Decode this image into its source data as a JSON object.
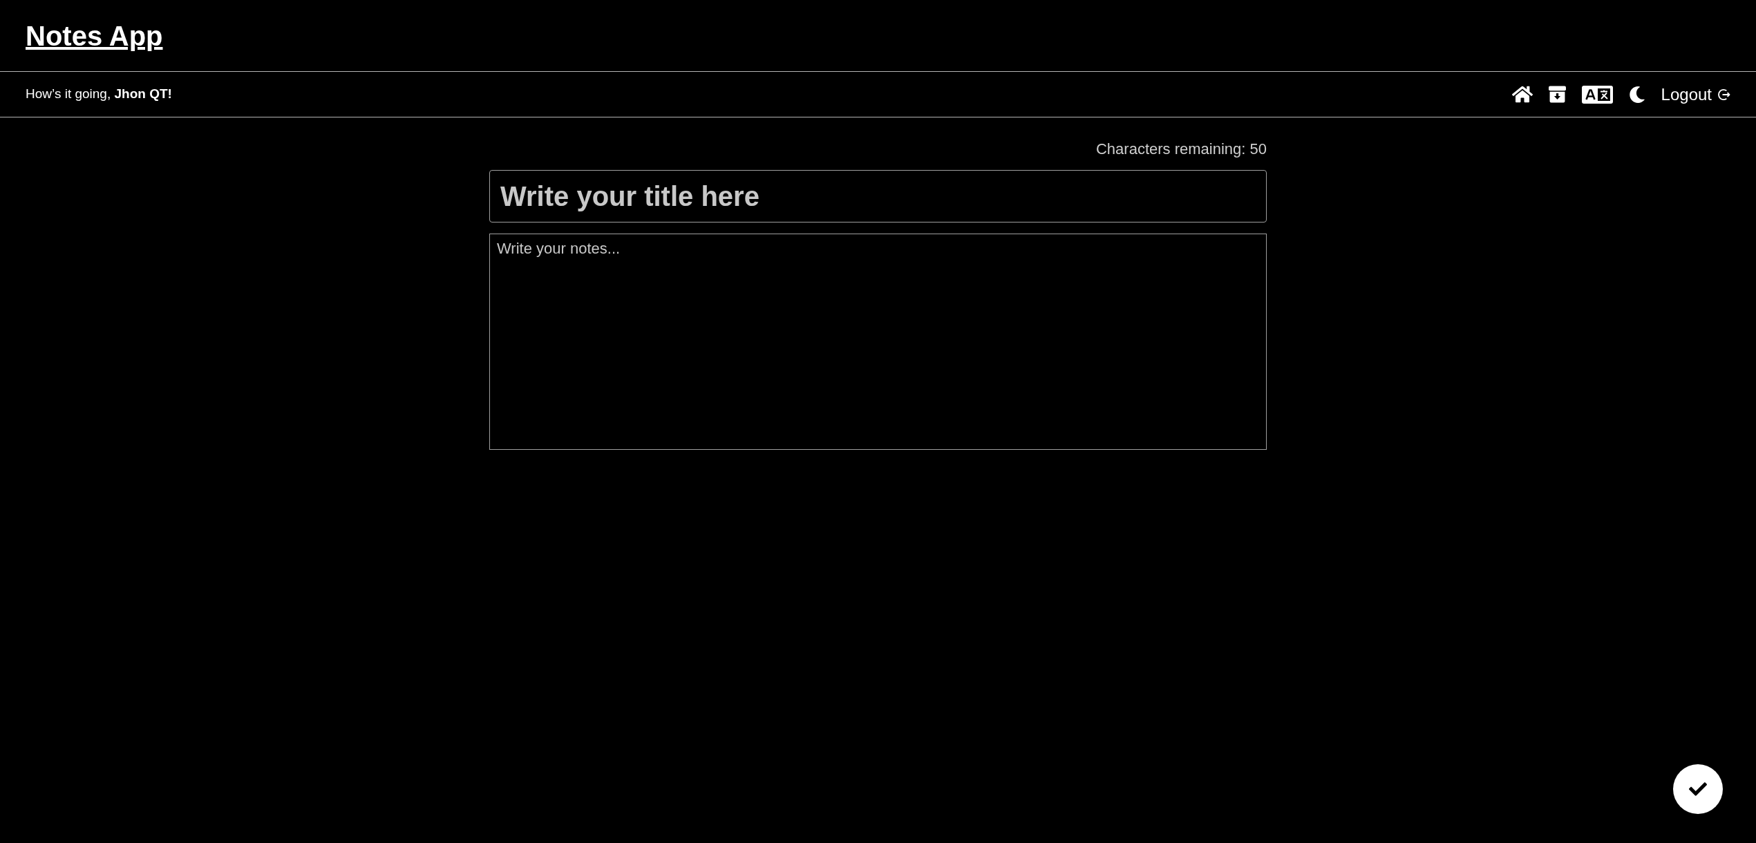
{
  "header": {
    "title": "Notes App"
  },
  "nav": {
    "greeting": "How’s it going, **Jhon QT!**",
    "logout": {
      "label": "Logout"
    }
  },
  "editor": {
    "counter": "Characters remaining: 50",
    "title_field": {
      "placeholder": "Write your title here"
    },
    "notes_field": {
      "placeholder": "Write your notes..."
    }
  }
}
